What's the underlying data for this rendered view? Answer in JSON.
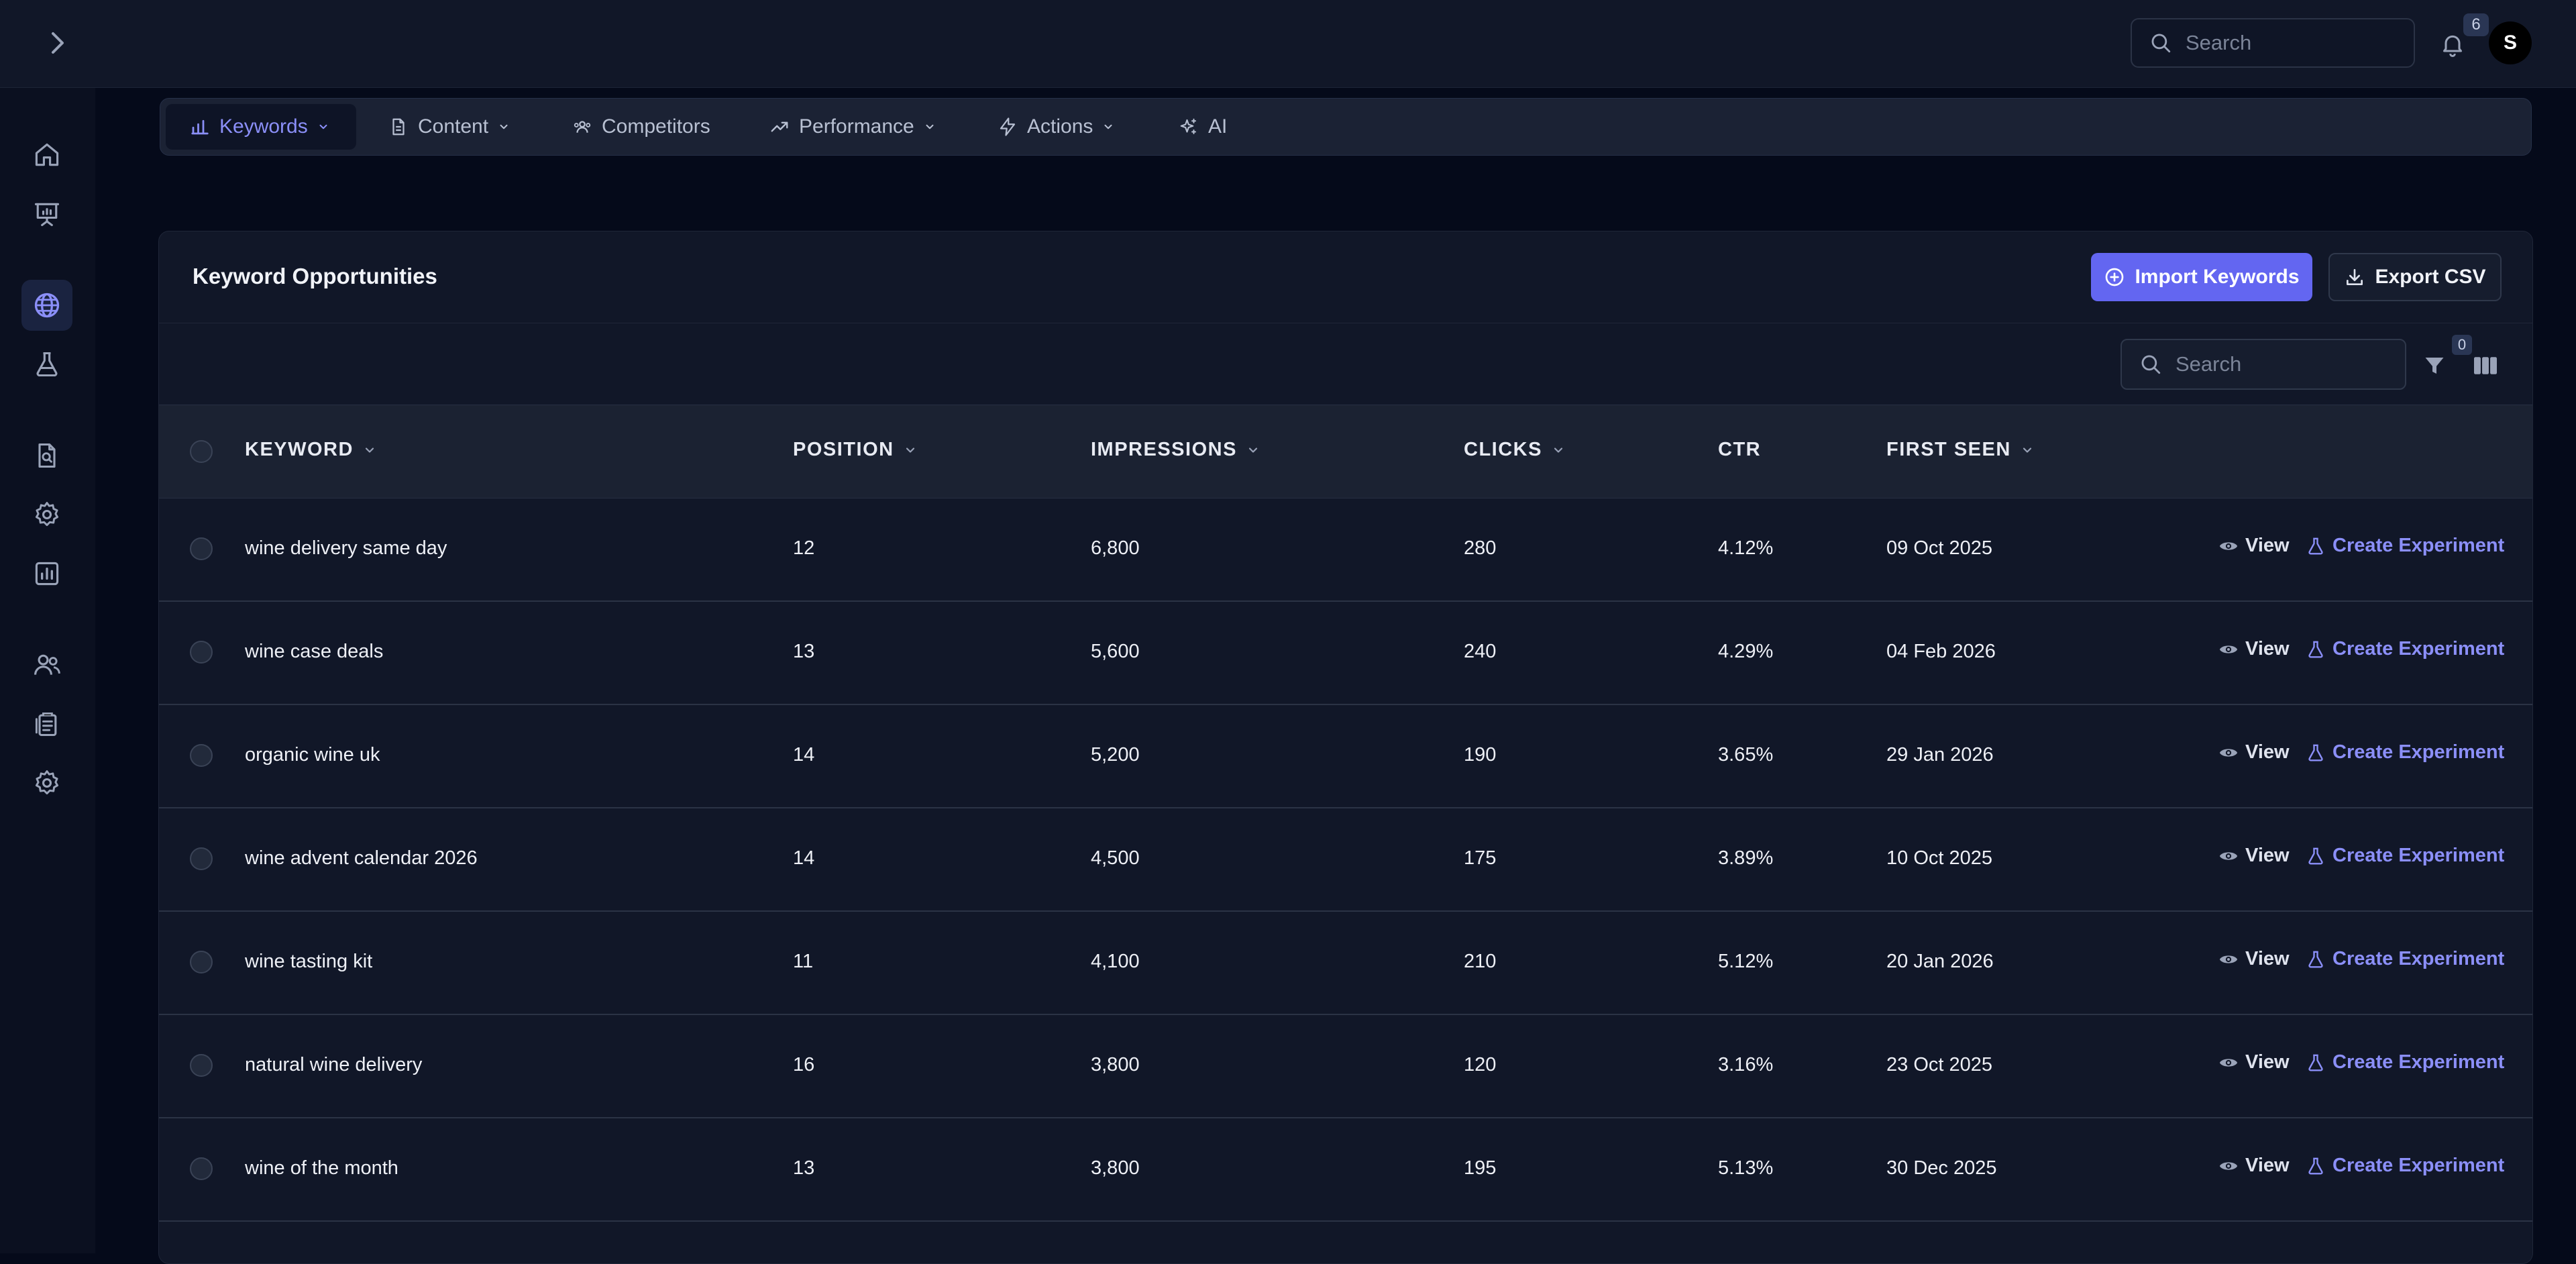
{
  "topbar": {
    "search_placeholder": "Search",
    "notification_count": "6",
    "avatar_initial": "S"
  },
  "sidebar": {
    "items": [
      {
        "name": "home",
        "icon": "home-icon",
        "active": false
      },
      {
        "name": "presentation",
        "icon": "presentation-chart-icon",
        "active": false
      },
      {
        "name": "globe",
        "icon": "globe-icon",
        "active": true
      },
      {
        "name": "experiments",
        "icon": "flask-icon",
        "active": false
      },
      {
        "name": "file-search",
        "icon": "file-search-icon",
        "active": false
      },
      {
        "name": "settings",
        "icon": "gear-icon",
        "active": false
      },
      {
        "name": "analytics",
        "icon": "bar-chart-icon",
        "active": false
      },
      {
        "name": "users",
        "icon": "users-icon",
        "active": false
      },
      {
        "name": "reports",
        "icon": "clipboard-icon",
        "active": false
      },
      {
        "name": "preferences",
        "icon": "gear-icon",
        "active": false
      }
    ]
  },
  "nav": {
    "tabs": [
      {
        "label": "Keywords",
        "icon": "bar-chart-icon",
        "has_dropdown": true,
        "active": true
      },
      {
        "label": "Content",
        "icon": "document-icon",
        "has_dropdown": true,
        "active": false
      },
      {
        "label": "Competitors",
        "icon": "users-icon",
        "has_dropdown": false,
        "active": false
      },
      {
        "label": "Performance",
        "icon": "trend-up-icon",
        "has_dropdown": true,
        "active": false
      },
      {
        "label": "Actions",
        "icon": "lightning-icon",
        "has_dropdown": true,
        "active": false
      },
      {
        "label": "AI",
        "icon": "sparkles-icon",
        "has_dropdown": false,
        "active": false
      }
    ]
  },
  "card": {
    "title": "Keyword Opportunities",
    "import_label": "Import Keywords",
    "export_label": "Export CSV",
    "search_placeholder": "Search",
    "filter_count": "0"
  },
  "table": {
    "headers": [
      {
        "label": "KEYWORD",
        "sortable": true
      },
      {
        "label": "POSITION",
        "sortable": true
      },
      {
        "label": "IMPRESSIONS",
        "sortable": true
      },
      {
        "label": "CLICKS",
        "sortable": true
      },
      {
        "label": "CTR",
        "sortable": false
      },
      {
        "label": "FIRST SEEN",
        "sortable": true
      }
    ],
    "view_label": "View",
    "experiment_label": "Create Experiment",
    "rows": [
      {
        "keyword": "wine delivery same day",
        "position": "12",
        "impressions": "6,800",
        "clicks": "280",
        "ctr": "4.12%",
        "first_seen": "09 Oct 2025"
      },
      {
        "keyword": "wine case deals",
        "position": "13",
        "impressions": "5,600",
        "clicks": "240",
        "ctr": "4.29%",
        "first_seen": "04 Feb 2026"
      },
      {
        "keyword": "organic wine uk",
        "position": "14",
        "impressions": "5,200",
        "clicks": "190",
        "ctr": "3.65%",
        "first_seen": "29 Jan 2026"
      },
      {
        "keyword": "wine advent calendar 2026",
        "position": "14",
        "impressions": "4,500",
        "clicks": "175",
        "ctr": "3.89%",
        "first_seen": "10 Oct 2025"
      },
      {
        "keyword": "wine tasting kit",
        "position": "11",
        "impressions": "4,100",
        "clicks": "210",
        "ctr": "5.12%",
        "first_seen": "20 Jan 2026"
      },
      {
        "keyword": "natural wine delivery",
        "position": "16",
        "impressions": "3,800",
        "clicks": "120",
        "ctr": "3.16%",
        "first_seen": "23 Oct 2025"
      },
      {
        "keyword": "wine of the month",
        "position": "13",
        "impressions": "3,800",
        "clicks": "195",
        "ctr": "5.13%",
        "first_seen": "30 Dec 2025"
      }
    ]
  },
  "colors": {
    "accent": "#6366f1",
    "accent_text": "#8b8ff8",
    "background": "#050a1a",
    "panel": "#111728"
  }
}
